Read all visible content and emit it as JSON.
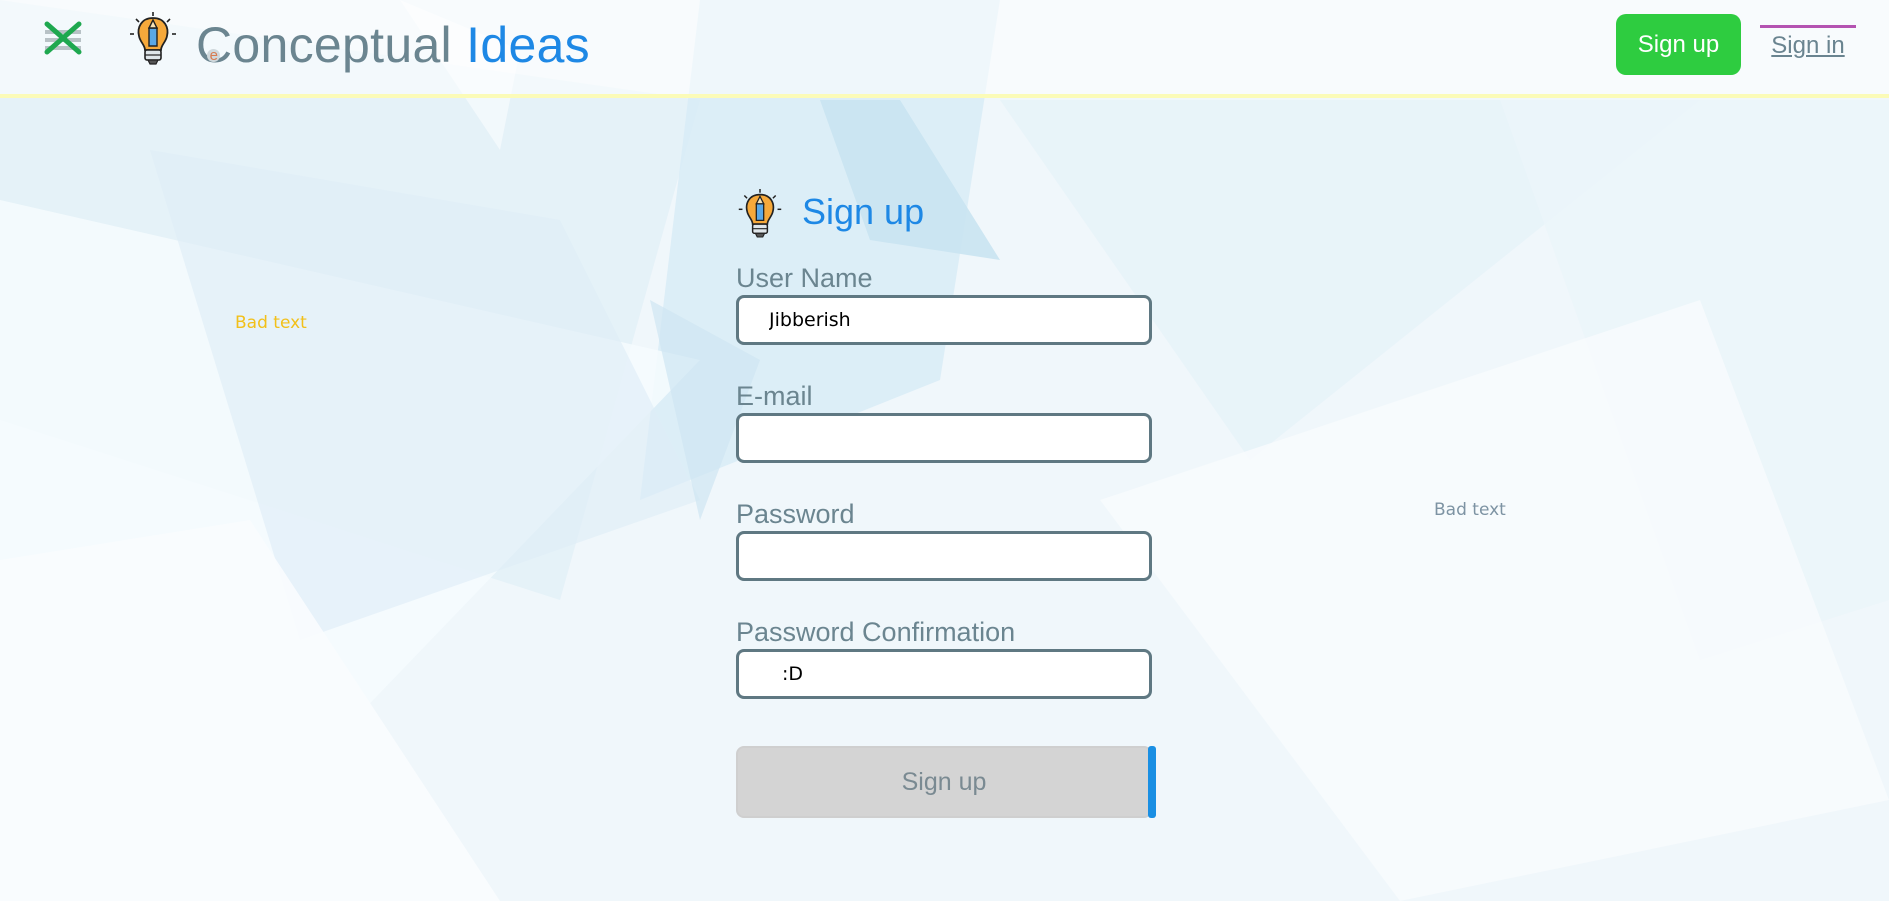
{
  "header": {
    "brand_part1": "C",
    "brand_small": "e",
    "brand_part2": "onceptual",
    "brand_part3": "Ideas",
    "signup_button": "Sign up",
    "signin_link": "Sign in"
  },
  "stray_text": {
    "left": "Bad text",
    "right": "Bad text"
  },
  "form": {
    "title": "Sign up",
    "username_label": "User Name",
    "username_value": "Jibberish",
    "email_label": "E-mail",
    "email_value": "",
    "password_label": "Password",
    "password_value": "",
    "password_confirmation_label": "Password Confirmation",
    "password_confirmation_value": ":D",
    "submit_label": "Sign up"
  },
  "colors": {
    "brand_gray": "#6b8590",
    "brand_blue": "#1e88e5",
    "signup_green": "#2ecc40",
    "link_underline_purple": "#b453b1",
    "header_border_yellow": "#fbfbb8",
    "bad_text_yellow": "#f2c01a",
    "bad_text_gray": "#7d93a3"
  },
  "icons": {
    "menu": "close-menu-icon",
    "logo": "lightbulb-pencil-icon"
  }
}
